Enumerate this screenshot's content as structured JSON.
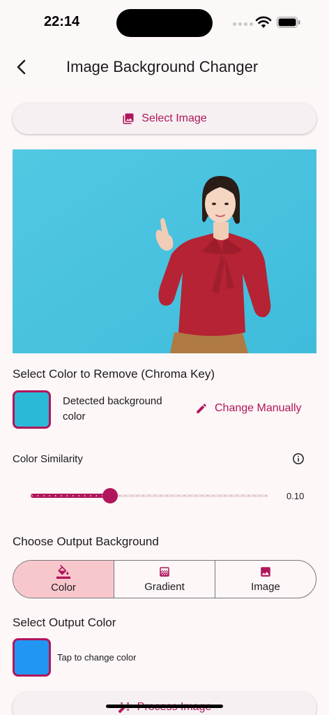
{
  "status_bar": {
    "time": "22:14"
  },
  "app_bar": {
    "title": "Image Background Changer"
  },
  "select_image": {
    "label": "Select Image"
  },
  "chroma_key": {
    "title": "Select Color to Remove (Chroma Key)",
    "detected_color": "#2bb9d8",
    "detected_label": "Detected background color",
    "change_label": "Change Manually"
  },
  "similarity": {
    "label": "Color Similarity",
    "value": 0.1,
    "value_text": "0.10",
    "min": 0,
    "max": 1.0
  },
  "output_background": {
    "title": "Choose Output Background",
    "options": [
      {
        "label": "Color",
        "icon": "format-color-fill-icon",
        "selected": true
      },
      {
        "label": "Gradient",
        "icon": "gradient-icon",
        "selected": false
      },
      {
        "label": "Image",
        "icon": "image-icon",
        "selected": false
      }
    ]
  },
  "output_color": {
    "title": "Select Output Color",
    "color": "#2196f3",
    "hint": "Tap to change color"
  },
  "process": {
    "label": "Process Image"
  },
  "colors": {
    "accent": "#b0165b",
    "selected_segment": "#f8c7cc",
    "preview_bg": "#4ac3e0"
  }
}
